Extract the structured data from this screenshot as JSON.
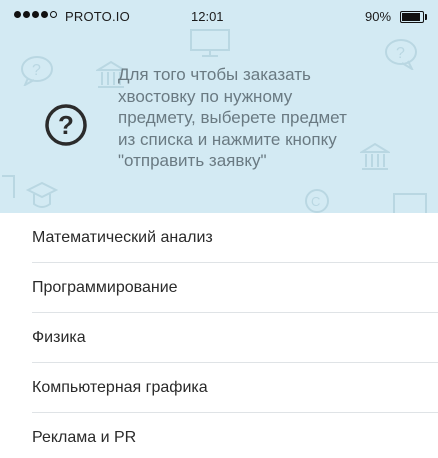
{
  "status_bar": {
    "carrier": "PROTO.IO",
    "time": "12:01",
    "battery": "90%"
  },
  "info": {
    "icon": "question-circle-icon",
    "lines": [
      "Для того чтобы заказать",
      "хвостовку по нужному",
      "предмету, выберете предмет",
      "из списка и нажмите кнопку",
      "\"отправить заявку\""
    ]
  },
  "subjects": [
    "Математический анализ",
    "Программирование",
    "Физика",
    "Компьютерная графика",
    "Реклама и PR"
  ],
  "colors": {
    "header_bg": "#d3eaf3",
    "text_muted": "#6a7a82",
    "list_text": "#2a2a2a",
    "divider": "#dfe3e6"
  }
}
